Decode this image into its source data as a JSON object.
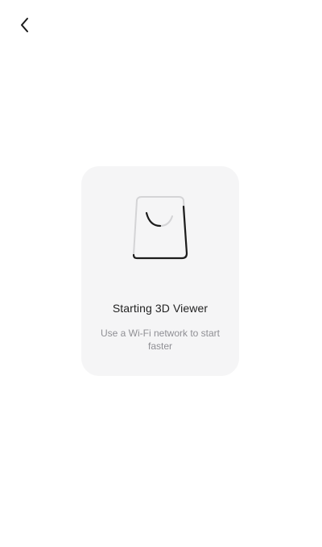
{
  "header": {
    "back_icon": "chevron-left-icon"
  },
  "card": {
    "icon": "shopping-bag-icon",
    "title": "Starting 3D Viewer",
    "subtitle": "Use a Wi-Fi network to start faster"
  },
  "colors": {
    "card_background": "#f5f5f6",
    "title_text": "#222222",
    "subtitle_text": "#8f8f94",
    "icon_dark": "#1c1c1c",
    "icon_light": "#d4d4d6"
  }
}
